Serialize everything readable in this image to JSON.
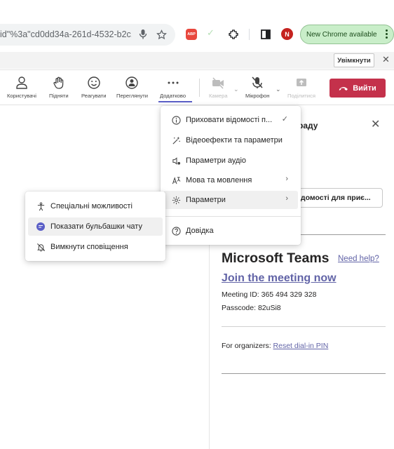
{
  "browser": {
    "url_text": "id\"%3a\"cd0dd34a-261d-4532-b2c...",
    "update_pill": "New Chrome available",
    "avatar_letter": "N",
    "abp_label": "ABP"
  },
  "infobar": {
    "enable_label": "Увімкнути",
    "close_glyph": "✕"
  },
  "toolbar": {
    "items": [
      {
        "label": "Користувачі",
        "icon": "people-icon"
      },
      {
        "label": "Підняти",
        "icon": "raise-hand-icon"
      },
      {
        "label": "Реагувати",
        "icon": "smile-icon"
      },
      {
        "label": "Переглянути",
        "icon": "view-icon"
      },
      {
        "label": "Додатково",
        "icon": "more-icon"
      },
      {
        "label": "Камера",
        "icon": "camera-off-icon"
      },
      {
        "label": "Мікрофон",
        "icon": "mic-off-icon"
      },
      {
        "label": "Поділитися",
        "icon": "share-icon"
      }
    ],
    "leave_label": "Вийти"
  },
  "main_menu": {
    "items": [
      {
        "label": "Приховати відомості п...",
        "icon": "info-icon",
        "right": "✓"
      },
      {
        "label": "Відеоефекти та параметри",
        "icon": "magic-wand-icon",
        "right": ""
      },
      {
        "label": "Параметри аудіо",
        "icon": "audio-settings-icon",
        "right": ""
      },
      {
        "label": "Мова та мовлення",
        "icon": "language-icon",
        "right": "›"
      },
      {
        "label": "Параметри",
        "icon": "gear-icon",
        "right": "›"
      },
      {
        "label": "Довідка",
        "icon": "help-icon",
        "right": ""
      }
    ]
  },
  "sub_menu": {
    "items": [
      {
        "label": "Спеціальні можливості",
        "icon": "accessibility-icon"
      },
      {
        "label": "Показати бульбашки чату",
        "icon": "chat-bubble-icon"
      },
      {
        "label": "Вимкнути сповіщення",
        "icon": "bell-off-icon"
      }
    ]
  },
  "panel": {
    "title_partial": "раду",
    "close_glyph": "✕",
    "button_partial": "ідомості для приє...",
    "ms_title": "Microsoft Teams",
    "need_help": "Need help?",
    "join_link": "Join the meeting now",
    "meeting_id": "Meeting ID: 365 494 329 328",
    "passcode": "Passcode: 82uSi8",
    "organizers_prefix": "For organizers: ",
    "organizers_link": "Reset dial-in PIN"
  }
}
